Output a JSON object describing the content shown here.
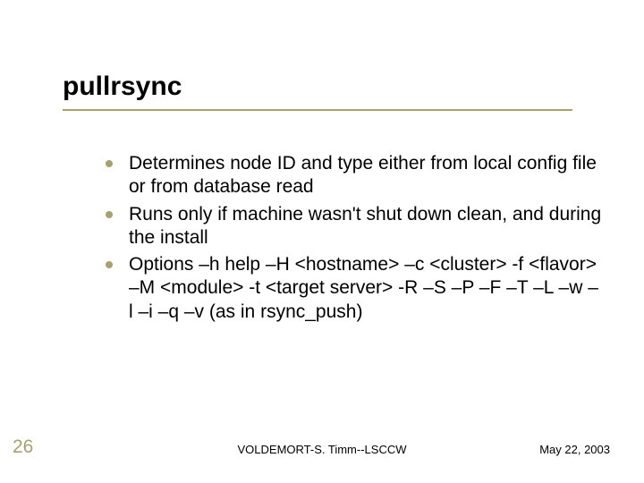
{
  "title": "pullrsync",
  "bullets": [
    "Determines node ID and type either from local config file or from database read",
    "Runs only if machine wasn't shut down clean, and during the install",
    "Options –h help –H <hostname>  –c <cluster> -f <flavor>  –M <module> -t <target server> -R –S –P –F –T –L –w –l –i –q –v (as in rsync_push)"
  ],
  "slide_number": "26",
  "footer_center": "VOLDEMORT-S. Timm--LSCCW",
  "footer_date": "May 22, 2003"
}
